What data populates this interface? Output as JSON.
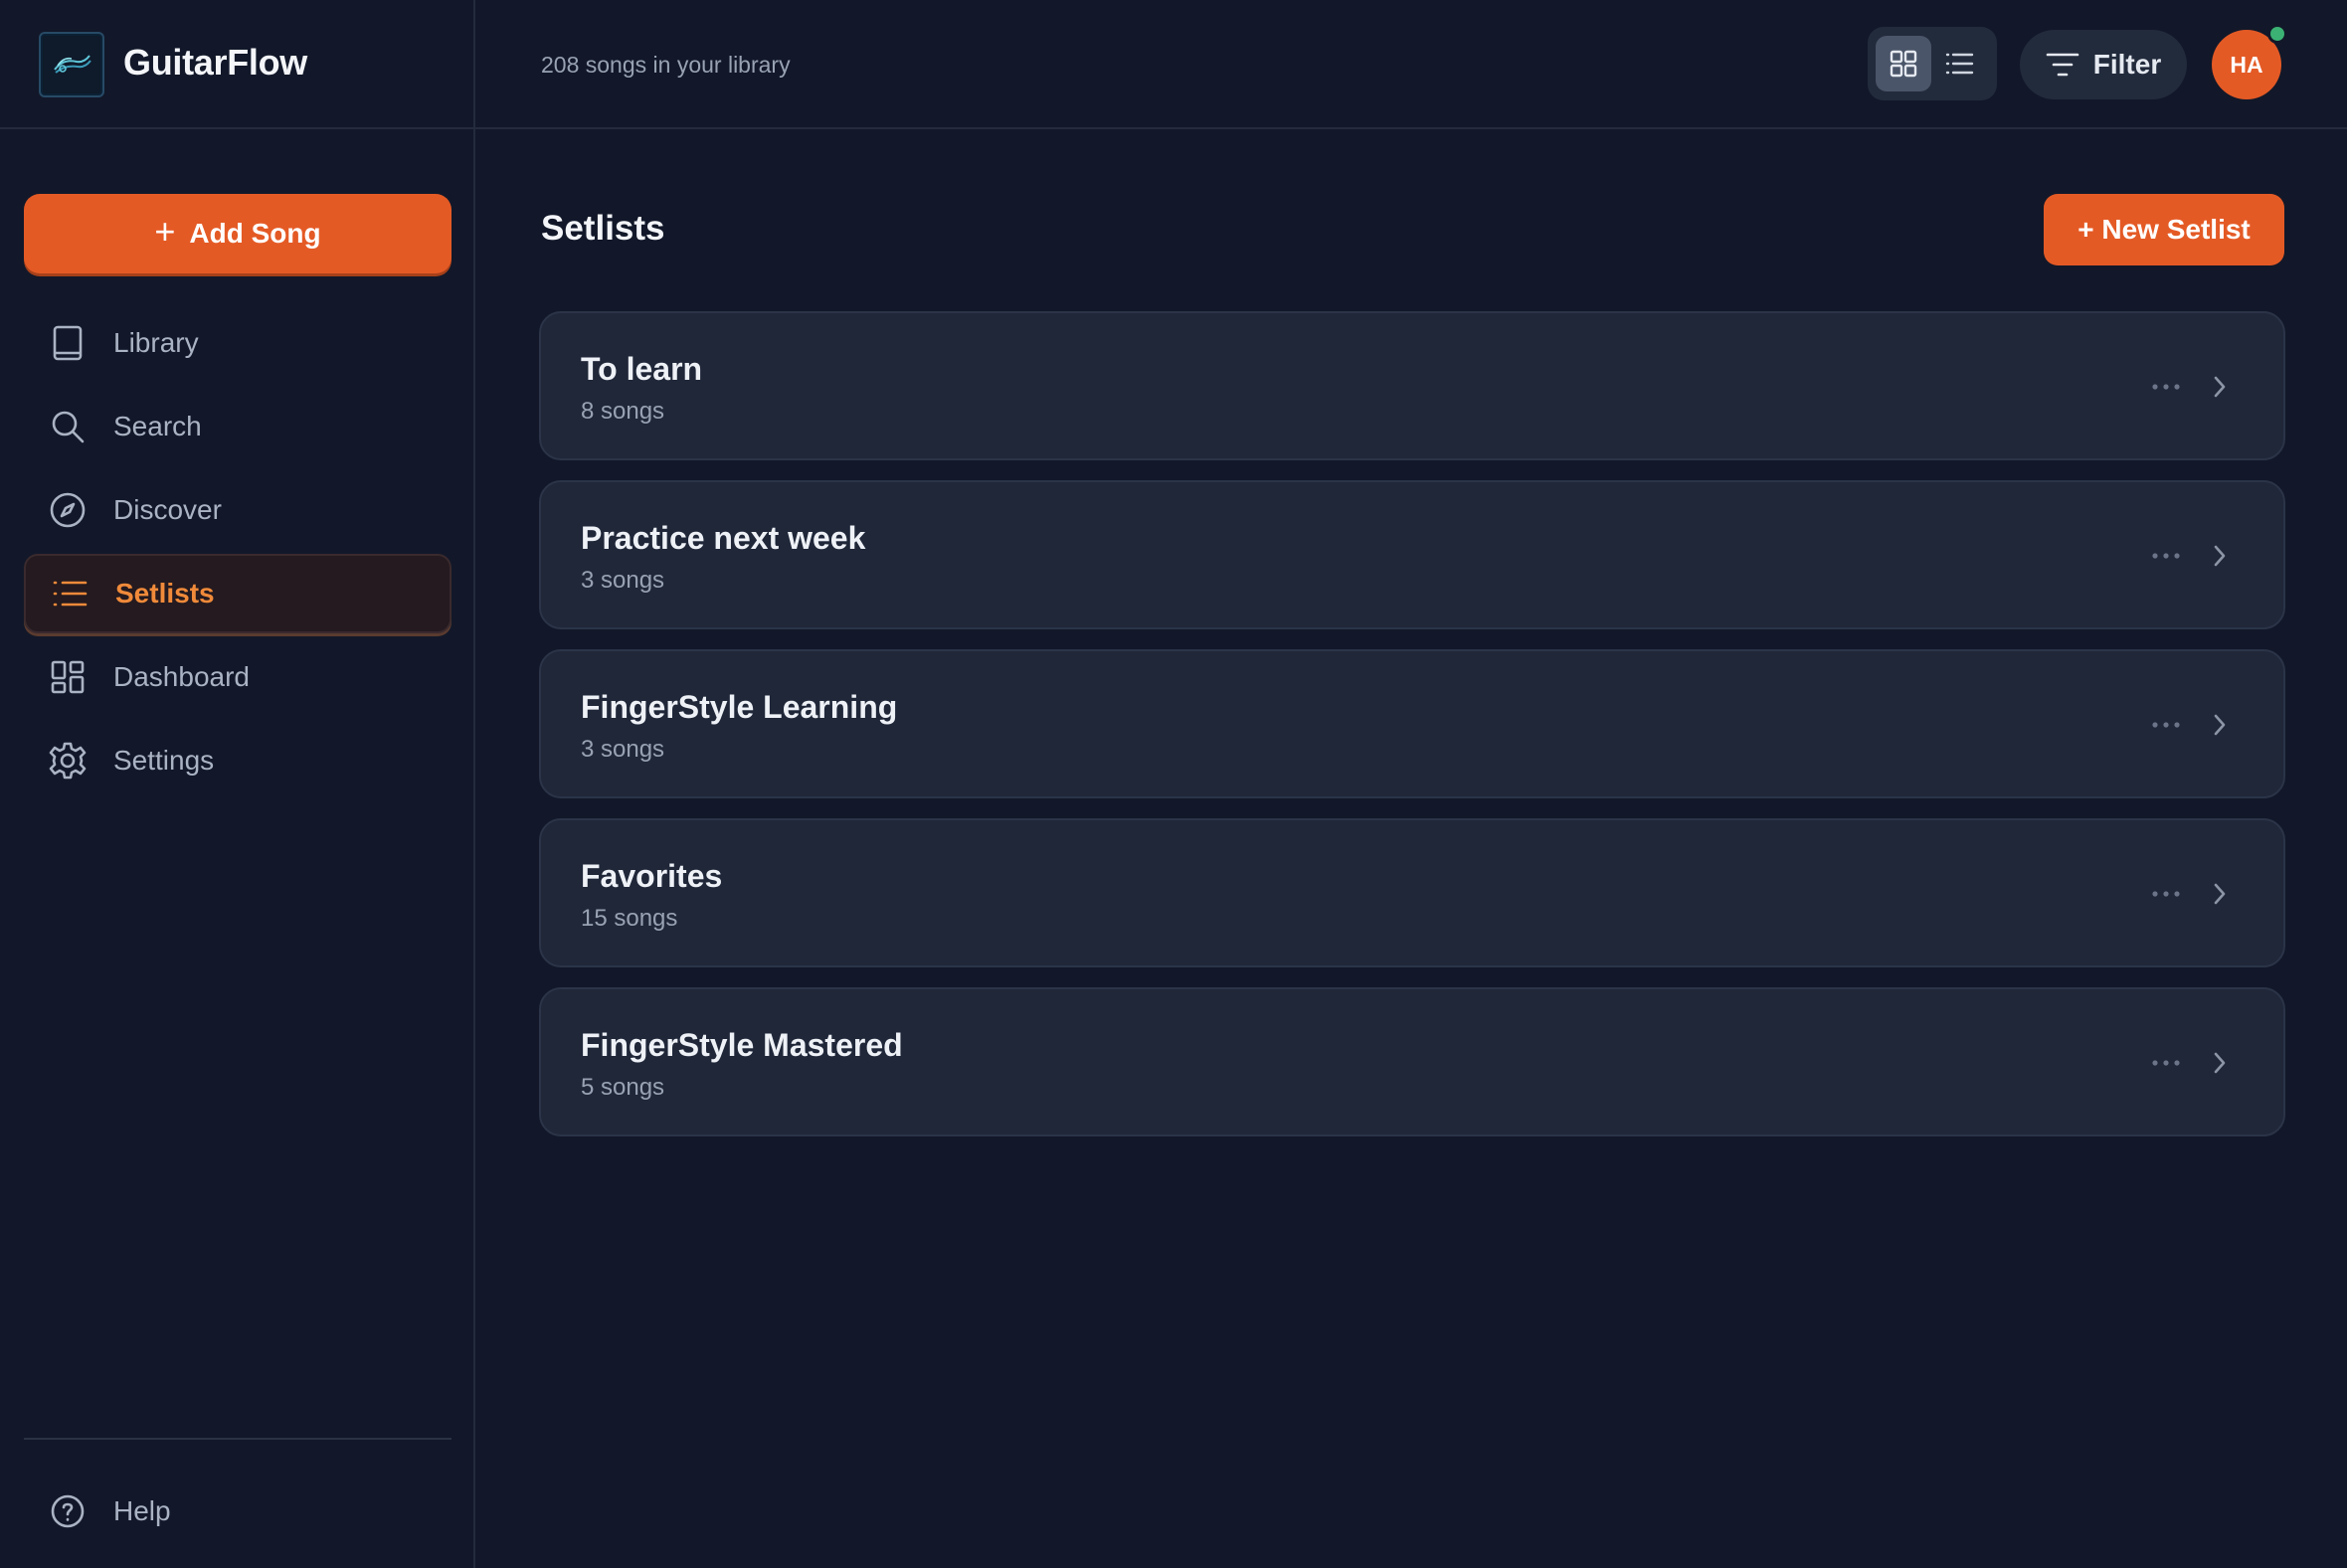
{
  "app": {
    "name": "GuitarFlow"
  },
  "sidebar": {
    "add_song_label": "Add Song",
    "items": [
      {
        "label": "Library",
        "icon": "book-icon",
        "active": false
      },
      {
        "label": "Search",
        "icon": "search-icon",
        "active": false
      },
      {
        "label": "Discover",
        "icon": "compass-icon",
        "active": false
      },
      {
        "label": "Setlists",
        "icon": "list-icon",
        "active": true
      },
      {
        "label": "Dashboard",
        "icon": "dashboard-icon",
        "active": false
      },
      {
        "label": "Settings",
        "icon": "gear-icon",
        "active": false
      }
    ],
    "help_label": "Help"
  },
  "topbar": {
    "library_count": "208 songs in your library",
    "view_mode": "grid",
    "filter_label": "Filter",
    "avatar_initials": "HA",
    "status": "online"
  },
  "main": {
    "title": "Setlists",
    "new_setlist_label": "+ New Setlist",
    "setlists": [
      {
        "name": "To learn",
        "count": "8 songs"
      },
      {
        "name": "Practice next week",
        "count": "3 songs"
      },
      {
        "name": "FingerStyle Learning",
        "count": "3 songs"
      },
      {
        "name": "Favorites",
        "count": "15 songs"
      },
      {
        "name": "FingerStyle Mastered",
        "count": "5 songs"
      }
    ]
  },
  "colors": {
    "accent": "#e45a25",
    "active_text": "#f08a3a",
    "background": "#121829",
    "card": "#1f2739",
    "online": "#3bb273"
  }
}
